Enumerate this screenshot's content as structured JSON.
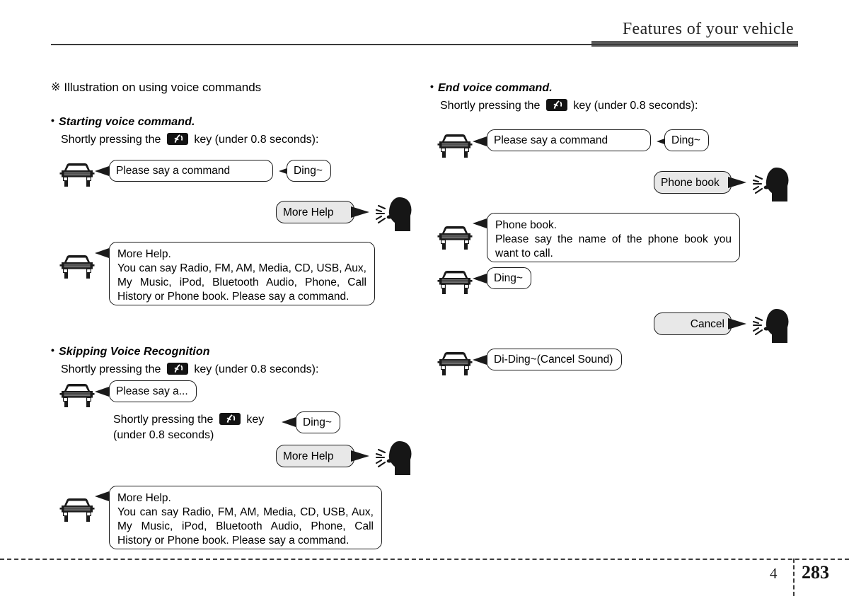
{
  "header": {
    "title": "Features of your vehicle"
  },
  "footer": {
    "chapter": "4",
    "page": "283"
  },
  "icons": {
    "star": "※",
    "bullet": "•",
    "car": "car-front-icon",
    "head": "speaking-head-icon",
    "voice_key": "voice-recognition-key-icon"
  },
  "left_column": {
    "note": "Illustration on using voice commands",
    "sections": [
      {
        "heading": "Starting voice command.",
        "instruction_before": "Shortly pressing the",
        "instruction_after": "key (under 0.8 seconds):",
        "bubbles": {
          "say_command": "Please say a command",
          "ding": "Ding~",
          "more_help_user": "More Help",
          "more_help_line1": "More Help.",
          "more_help_line2": "You can say Radio, FM, AM, Media, CD, USB, Aux,",
          "more_help_line3": "My Music, iPod, Bluetooth Audio, Phone, Call",
          "more_help_line4": "History or Phone book. Please say a command."
        }
      },
      {
        "heading": "Skipping Voice Recognition",
        "instruction_before": "Shortly pressing the",
        "instruction_after": "key (under 0.8 seconds):",
        "inner_instruction_before": "Shortly pressing the",
        "inner_instruction_after": "key",
        "inner_instruction_line2": "(under 0.8 seconds)",
        "bubbles": {
          "say_partial": "Please say a...",
          "ding": "Ding~",
          "more_help_user": "More Help",
          "more_help_line1": "More Help.",
          "more_help_line2": "You can say Radio, FM, AM, Media, CD, USB, Aux,",
          "more_help_line3": "My Music, iPod, Bluetooth Audio, Phone, Call",
          "more_help_line4": "History or Phone book. Please say a command."
        }
      }
    ]
  },
  "right_column": {
    "sections": [
      {
        "heading": "End voice command.",
        "instruction_before": "Shortly pressing the",
        "instruction_after": "key (under 0.8 seconds):",
        "bubbles": {
          "say_command": "Please say a command",
          "ding1": "Ding~",
          "phone_book_user": "Phone book",
          "phone_book_line1": "Phone book.",
          "phone_book_line2": "Please say the name of the phone book you",
          "phone_book_line3": "want to call.",
          "ding2": "Ding~",
          "cancel_user": "Cancel",
          "cancel_sound": "Di-Ding~(Cancel Sound)"
        }
      }
    ]
  },
  "colors": {
    "user_bubble_bg": "#e8e8e8",
    "system_bubble_bg": "#ffffff",
    "outline": "#1a1a1a",
    "rule": "#5a5a5a"
  }
}
